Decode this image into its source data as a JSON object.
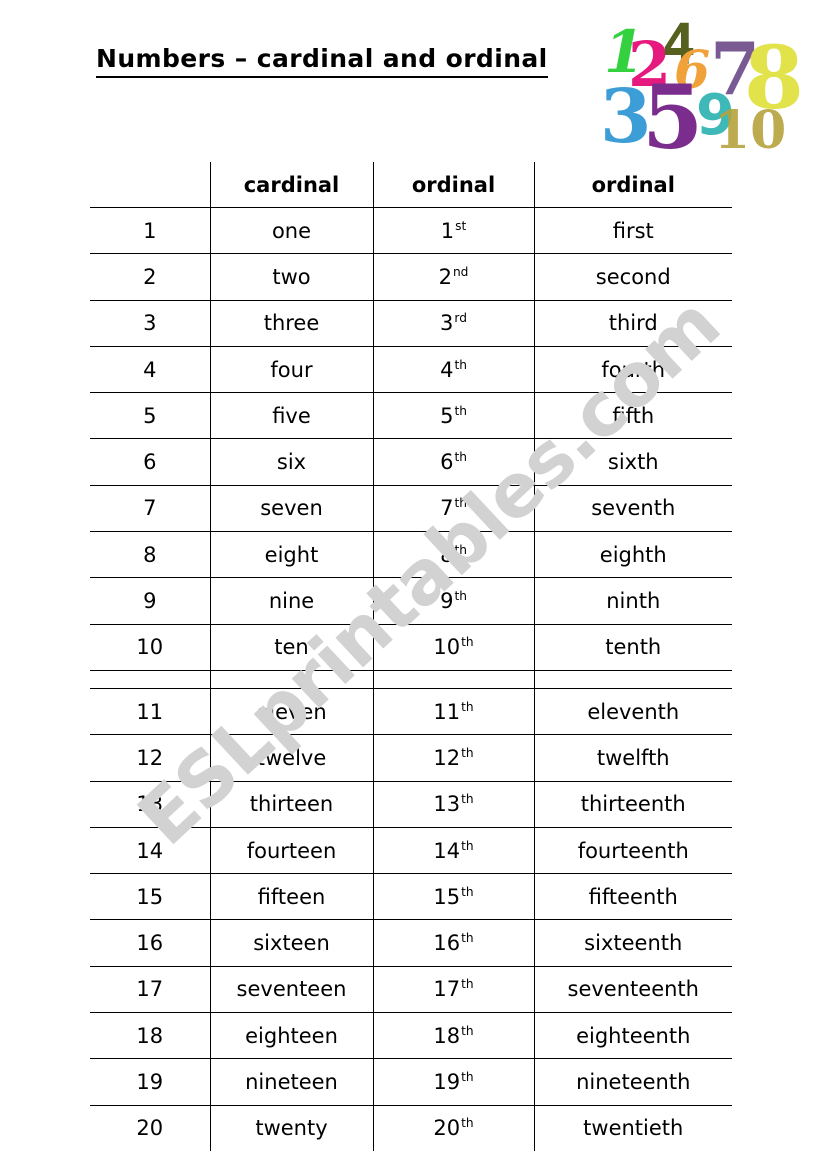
{
  "document": {
    "title": "Numbers – cardinal and ordinal",
    "watermark": "ESLprintables.com"
  },
  "clipart": {
    "name": "colorful-numbers-clipart",
    "numbers": [
      {
        "glyph": "1",
        "color": "#33d13f"
      },
      {
        "glyph": "2",
        "color": "#e6197f"
      },
      {
        "glyph": "4",
        "color": "#56601f"
      },
      {
        "glyph": "6",
        "color": "#f0a13a"
      },
      {
        "glyph": "7",
        "color": "#7a5a93"
      },
      {
        "glyph": "8",
        "color": "#e2e34a"
      },
      {
        "glyph": "3",
        "color": "#3d9dd6"
      },
      {
        "glyph": "5",
        "color": "#7b2d8e"
      },
      {
        "glyph": "9",
        "color": "#3fb8b8"
      },
      {
        "glyph": "10",
        "color": "#b5a23c"
      }
    ]
  },
  "table": {
    "headers": [
      "",
      "cardinal",
      "ordinal",
      "ordinal"
    ],
    "rows": [
      {
        "num": "1",
        "cardinal": "one",
        "ordinal_num": "1",
        "ordinal_suffix": "st",
        "ordinal_word": "first"
      },
      {
        "num": "2",
        "cardinal": "two",
        "ordinal_num": "2",
        "ordinal_suffix": "nd",
        "ordinal_word": "second"
      },
      {
        "num": "3",
        "cardinal": "three",
        "ordinal_num": "3",
        "ordinal_suffix": "rd",
        "ordinal_word": "third"
      },
      {
        "num": "4",
        "cardinal": "four",
        "ordinal_num": "4",
        "ordinal_suffix": "th",
        "ordinal_word": "fourth"
      },
      {
        "num": "5",
        "cardinal": "five",
        "ordinal_num": "5",
        "ordinal_suffix": "th",
        "ordinal_word": "fifth"
      },
      {
        "num": "6",
        "cardinal": "six",
        "ordinal_num": "6",
        "ordinal_suffix": "th",
        "ordinal_word": "sixth"
      },
      {
        "num": "7",
        "cardinal": "seven",
        "ordinal_num": "7",
        "ordinal_suffix": "th",
        "ordinal_word": "seventh"
      },
      {
        "num": "8",
        "cardinal": "eight",
        "ordinal_num": "8",
        "ordinal_suffix": "th",
        "ordinal_word": "eighth"
      },
      {
        "num": "9",
        "cardinal": "nine",
        "ordinal_num": "9",
        "ordinal_suffix": "th",
        "ordinal_word": "ninth"
      },
      {
        "num": "10",
        "cardinal": "ten",
        "ordinal_num": "10",
        "ordinal_suffix": "th",
        "ordinal_word": "tenth"
      },
      {
        "spacer": true
      },
      {
        "num": "11",
        "cardinal": "eleven",
        "ordinal_num": "11",
        "ordinal_suffix": "th",
        "ordinal_word": "eleventh"
      },
      {
        "num": "12",
        "cardinal": "twelve",
        "ordinal_num": "12",
        "ordinal_suffix": "th",
        "ordinal_word": "twelfth"
      },
      {
        "num": "13",
        "cardinal": "thirteen",
        "ordinal_num": "13",
        "ordinal_suffix": "th",
        "ordinal_word": "thirteenth"
      },
      {
        "num": "14",
        "cardinal": "fourteen",
        "ordinal_num": "14",
        "ordinal_suffix": "th",
        "ordinal_word": "fourteenth"
      },
      {
        "num": "15",
        "cardinal": "fifteen",
        "ordinal_num": "15",
        "ordinal_suffix": "th",
        "ordinal_word": "fifteenth"
      },
      {
        "num": "16",
        "cardinal": "sixteen",
        "ordinal_num": "16",
        "ordinal_suffix": "th",
        "ordinal_word": "sixteenth"
      },
      {
        "num": "17",
        "cardinal": "seventeen",
        "ordinal_num": "17",
        "ordinal_suffix": "th",
        "ordinal_word": "seventeenth"
      },
      {
        "num": "18",
        "cardinal": "eighteen",
        "ordinal_num": "18",
        "ordinal_suffix": "th",
        "ordinal_word": "eighteenth"
      },
      {
        "num": "19",
        "cardinal": "nineteen",
        "ordinal_num": "19",
        "ordinal_suffix": "th",
        "ordinal_word": "nineteenth"
      },
      {
        "num": "20",
        "cardinal": "twenty",
        "ordinal_num": "20",
        "ordinal_suffix": "th",
        "ordinal_word": "twentieth"
      }
    ]
  }
}
